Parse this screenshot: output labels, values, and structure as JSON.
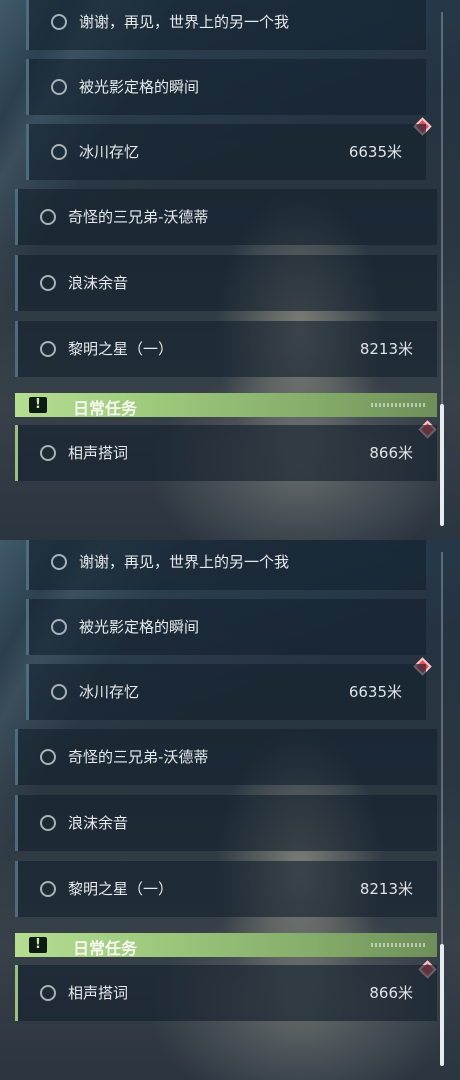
{
  "quests": {
    "main_quests": [
      {
        "title": "谢谢，再见，世界上的另一个我",
        "distance": ""
      },
      {
        "title": "被光影定格的瞬间",
        "distance": ""
      },
      {
        "title": "冰川存忆",
        "distance": "6635米"
      },
      {
        "title": "奇怪的三兄弟-沃德蒂",
        "distance": ""
      },
      {
        "title": "浪沫余音",
        "distance": ""
      },
      {
        "title": "黎明之星（一）",
        "distance": "8213米"
      }
    ],
    "daily_header": "日常任务",
    "daily_badge": "!",
    "daily_quests": [
      {
        "title": "相声搭词",
        "distance": "866米"
      }
    ]
  },
  "colors": {
    "daily_accent": "#9fc07a",
    "marker": "#e44f5a",
    "row_border": "#4f6c7e"
  },
  "icons": [
    "quest-circle-icon",
    "map-marker-diamond-icon",
    "alert-badge-icon"
  ]
}
